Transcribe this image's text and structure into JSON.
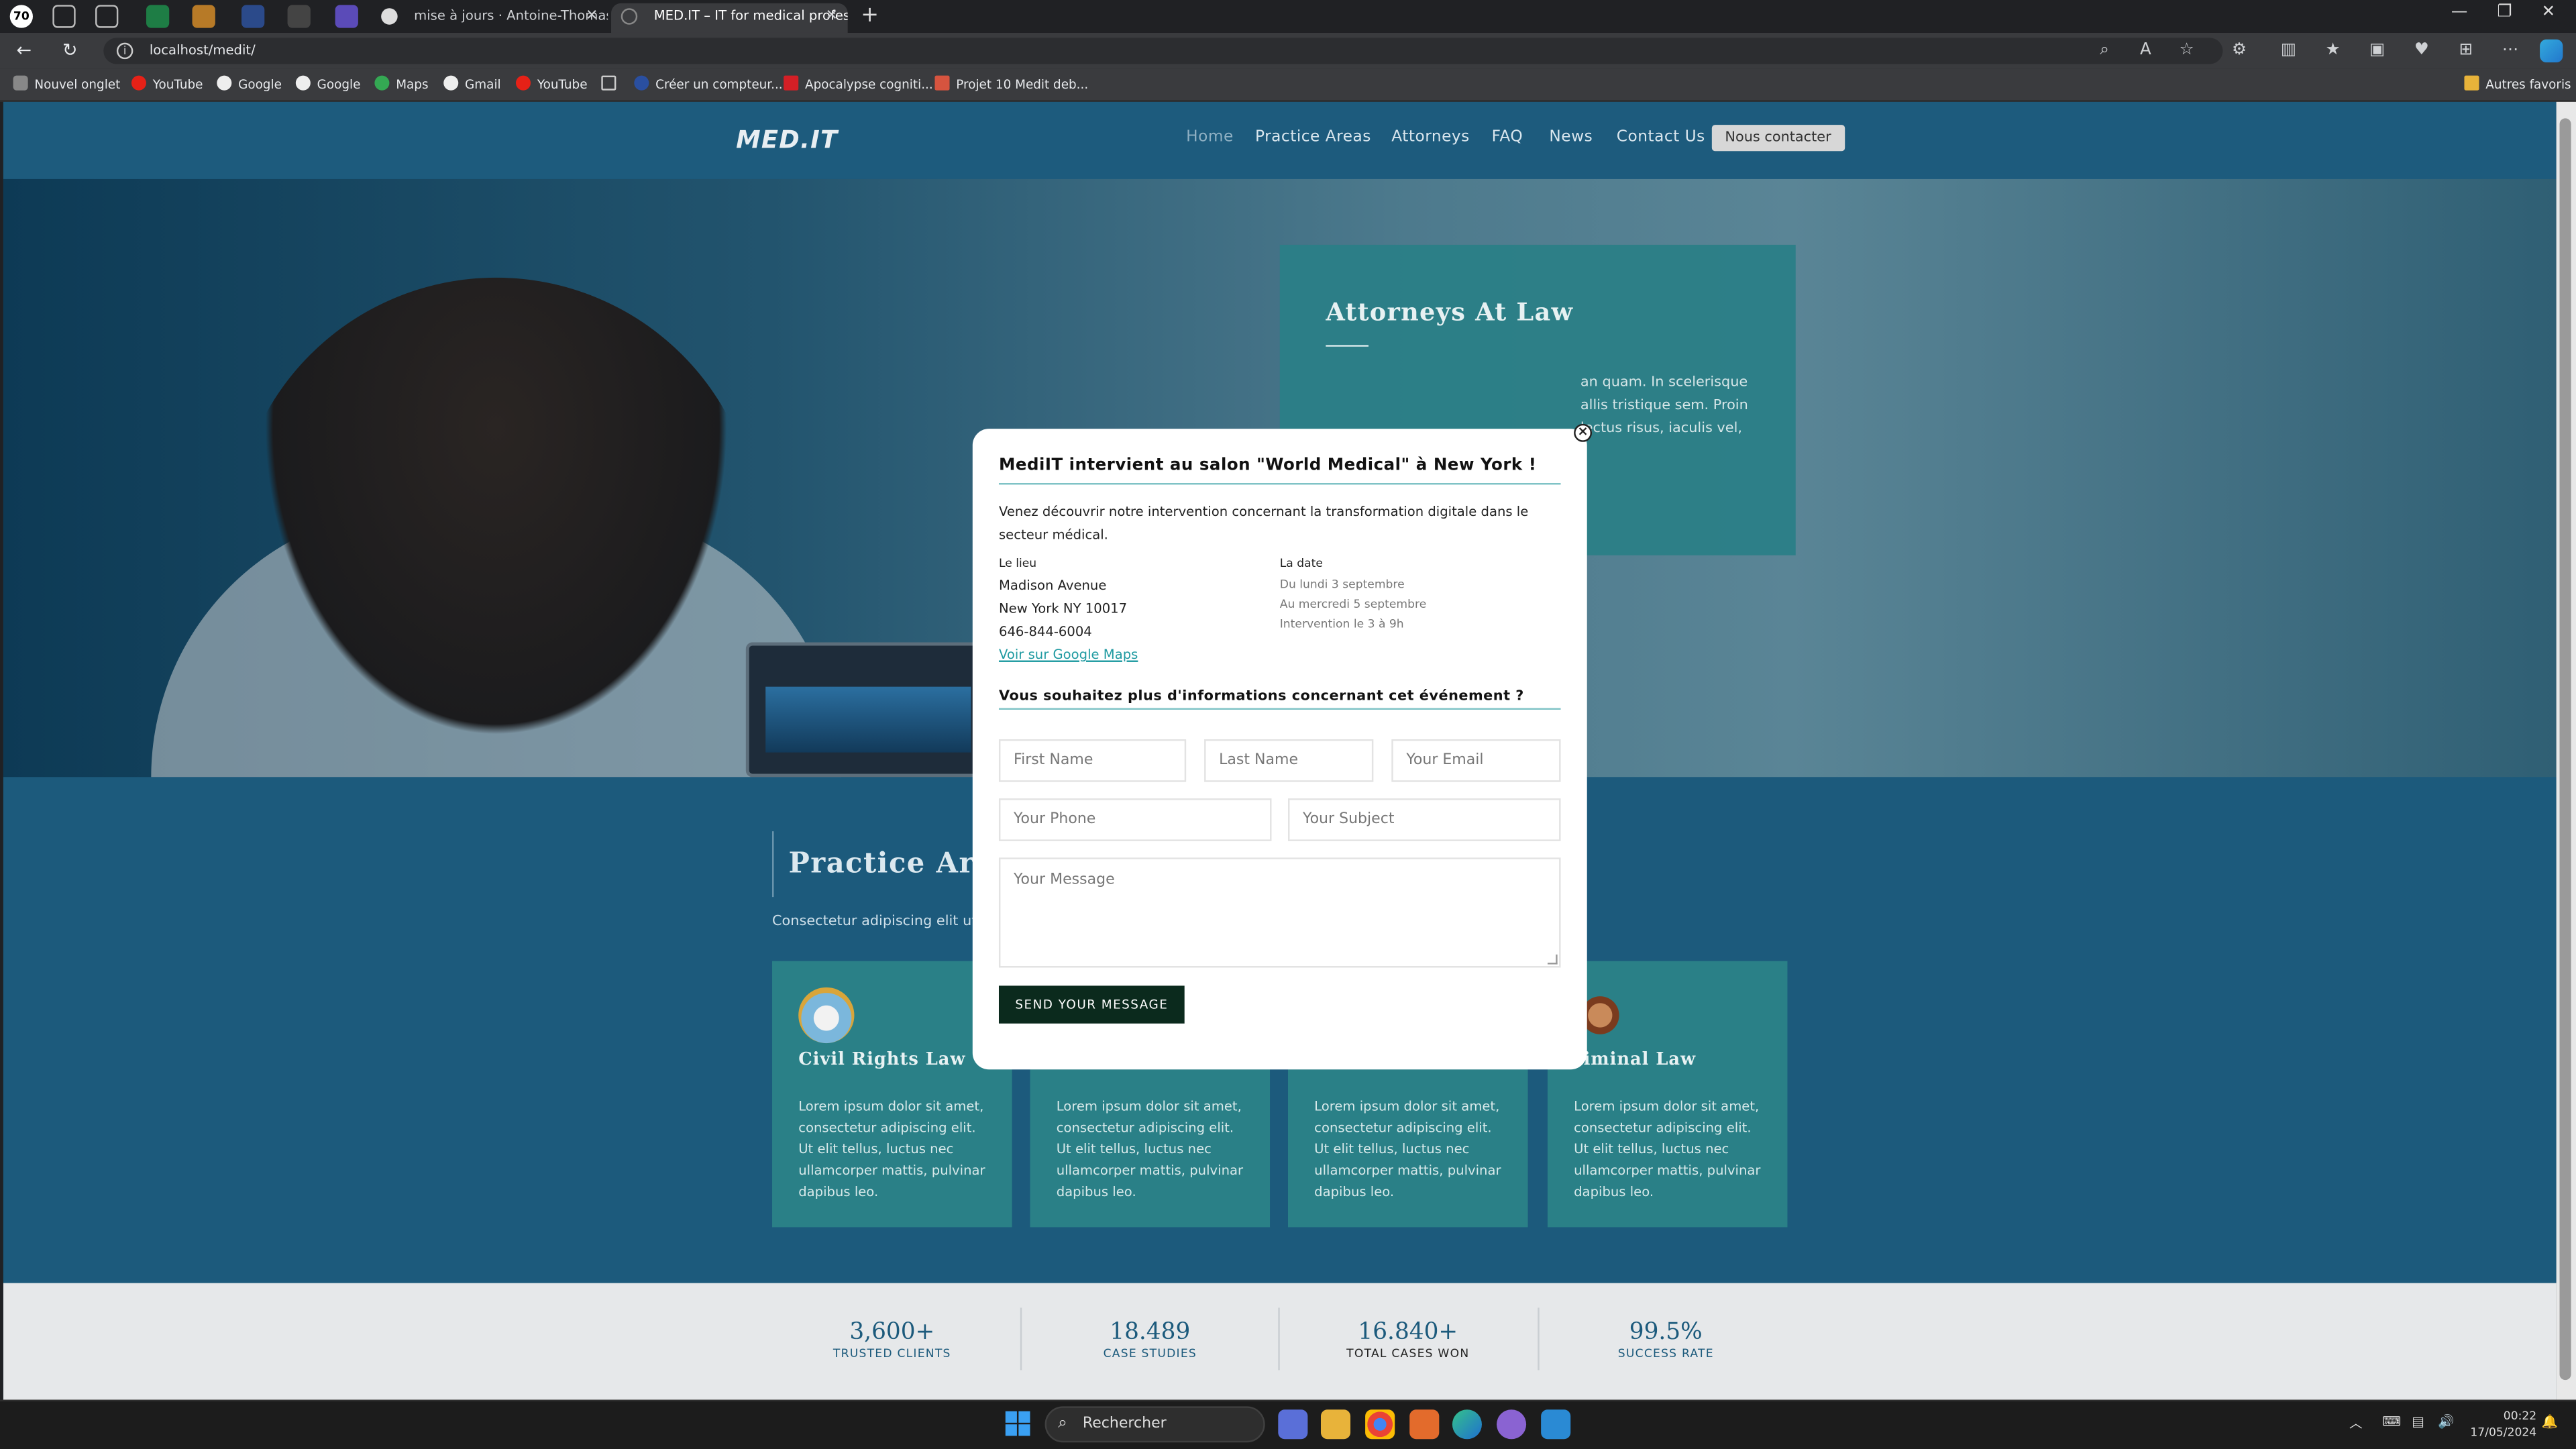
{
  "browser": {
    "tabs": [
      {
        "label": "mise à jours · Antoine-Thomas/r"
      },
      {
        "label": "MED.IT – IT for medical professio"
      }
    ],
    "url": "localhost/medit/",
    "bookmarks": [
      "Nouvel onglet",
      "YouTube",
      "Google",
      "Google",
      "Maps",
      "Gmail",
      "YouTube",
      "",
      "Créer un compteur...",
      "Apocalypse cogniti...",
      "Projet 10 Medit deb..."
    ],
    "other_bookmarks": "Autres favoris"
  },
  "site": {
    "logo": "MED.IT",
    "nav": [
      "Home",
      "Practice Areas",
      "Attorneys",
      "FAQ",
      "News",
      "Contact Us"
    ],
    "cta": "Nous contacter",
    "hero": {
      "title": "Attorneys At Law",
      "text": "an quam. In scelerisque allis tristique sem. Proin lectus risus, iaculis vel,"
    },
    "practice": {
      "title": "Practice Ar",
      "subtitle": "Consectetur adipiscing elit ut e",
      "cards": [
        {
          "title": "Civil Rights Law",
          "body": "Lorem ipsum dolor sit amet, consectetur adipiscing elit. Ut elit tellus, luctus nec ullamcorper mattis, pulvinar dapibus leo."
        },
        {
          "title": "",
          "body": "Lorem ipsum dolor sit amet, consectetur adipiscing elit. Ut elit tellus, luctus nec ullamcorper mattis, pulvinar dapibus leo."
        },
        {
          "title": "",
          "body": "Lorem ipsum dolor sit amet, consectetur adipiscing elit. Ut elit tellus, luctus nec ullamcorper mattis, pulvinar dapibus leo."
        },
        {
          "title": "riminal Law",
          "body": "Lorem ipsum dolor sit amet, consectetur adipiscing elit. Ut elit tellus, luctus nec ullamcorper mattis, pulvinar dapibus leo."
        }
      ]
    },
    "stats": [
      {
        "value": "3,600+",
        "label": "TRUSTED CLIENTS"
      },
      {
        "value": "18.489",
        "label": "CASE STUDIES"
      },
      {
        "value": "16.840+",
        "label": "TOTAL CASES WON"
      },
      {
        "value": "99.5%",
        "label": "SUCCESS RATE"
      }
    ]
  },
  "modal": {
    "title": "MediIT intervient au salon \"World Medical\" à New York !",
    "intro": "Venez découvrir notre intervention concernant la transformation digitale dans le secteur médical.",
    "place_label": "Le lieu",
    "place_lines": [
      "Madison Avenue",
      "New York NY 10017",
      "646-844-6004"
    ],
    "maps_link": "Voir sur Google Maps",
    "date_label": "La date",
    "date_lines": [
      "Du lundi 3 septembre",
      "Au mercredi 5 septembre",
      "Intervention le 3 à 9h"
    ],
    "question": "Vous souhaitez plus d'informations concernant cet événement ?",
    "fields": {
      "first_name": "First Name",
      "last_name": "Last Name",
      "email": "Your Email",
      "phone": "Your Phone",
      "subject": "Your Subject",
      "message": "Your Message"
    },
    "send": "SEND YOUR MESSAGE"
  },
  "taskbar": {
    "search": "Rechercher",
    "time": "00:22",
    "date": "17/05/2024"
  }
}
